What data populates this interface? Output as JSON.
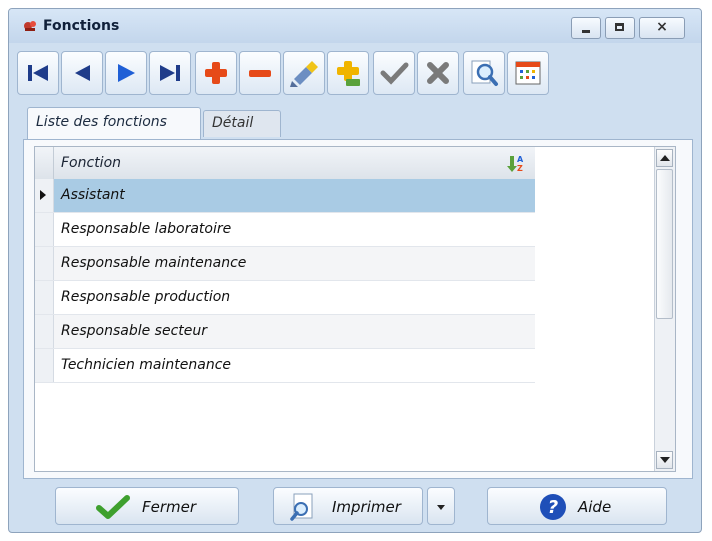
{
  "window": {
    "title": "Fonctions"
  },
  "toolbar": {
    "buttons": [
      {
        "name": "first-record-button",
        "icon": "first-record-icon"
      },
      {
        "name": "previous-record-button",
        "icon": "previous-record-icon"
      },
      {
        "name": "next-record-button",
        "icon": "next-record-icon"
      },
      {
        "name": "last-record-button",
        "icon": "last-record-icon"
      },
      {
        "name": "add-record-button",
        "icon": "plus-icon"
      },
      {
        "name": "delete-record-button",
        "icon": "minus-icon"
      },
      {
        "name": "edit-record-button",
        "icon": "brush-icon"
      },
      {
        "name": "duplicate-record-button",
        "icon": "plus-copy-icon"
      },
      {
        "name": "validate-button",
        "icon": "check-icon"
      },
      {
        "name": "cancel-button",
        "icon": "cross-icon"
      },
      {
        "name": "search-button",
        "icon": "magnifier-icon"
      },
      {
        "name": "grid-settings-button",
        "icon": "grid-icon"
      }
    ]
  },
  "tabs": [
    {
      "label": "Liste des fonctions",
      "active": true
    },
    {
      "label": "Détail",
      "active": false
    }
  ],
  "grid": {
    "column_header": "Fonction",
    "rows": [
      "Assistant",
      "Responsable laboratoire",
      "Responsable maintenance",
      "Responsable production",
      "Responsable secteur",
      "Technicien maintenance"
    ],
    "selected_row": "Assistant"
  },
  "footer": {
    "close_label": "Fermer",
    "print_label": "Imprimer",
    "help_label": "Aide"
  },
  "colors": {
    "selection": "#a9cbe4",
    "window_bg": "#cfdff0",
    "accent_blue": "#1f5fd6",
    "accent_red": "#e64a19"
  }
}
